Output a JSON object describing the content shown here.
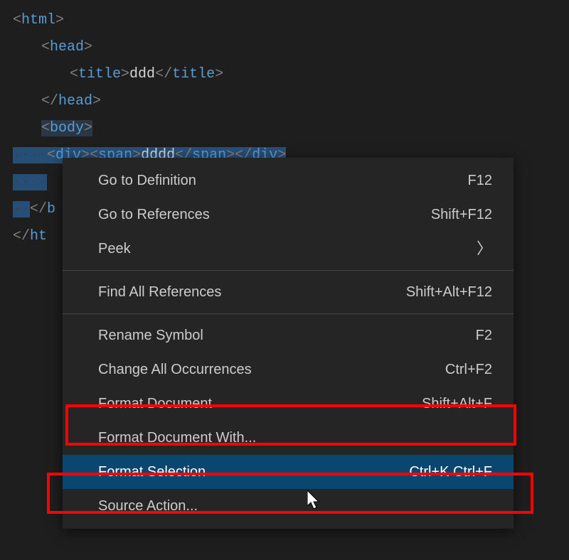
{
  "code": {
    "line1": {
      "open_br": "<",
      "tag": "html",
      "close_br": ">"
    },
    "line2": {
      "open_br": "<",
      "tag": "head",
      "close_br": ">"
    },
    "line3": {
      "open_br_o": "<",
      "tag_o": "title",
      "close_br_o": ">",
      "text": "ddd",
      "open_br_c": "</",
      "tag_c": "title",
      "close_br_c": ">"
    },
    "line4": {
      "open_br": "</",
      "tag": "head",
      "close_br": ">"
    },
    "line5": {
      "open_br": "<",
      "tag": "body",
      "close_br": ">"
    },
    "line6": {
      "ws": "····",
      "div_o_lt": "<",
      "div_o_tag": "div",
      "div_o_gt": ">",
      "span_o_lt": "<",
      "span_o_tag": "span",
      "span_o_gt": ">",
      "text": "dddd",
      "span_c_lt": "</",
      "span_c_tag": "span",
      "span_c_gt": ">",
      "div_c_lt": "</",
      "div_c_tag": "div",
      "div_c_gt": ">"
    },
    "line7": {
      "ws": "····"
    },
    "line8": {
      "ws": "··",
      "open_br": "</",
      "tag_partial": "b"
    },
    "line9": {
      "open_br": "</",
      "tag_partial": "ht"
    }
  },
  "menu": {
    "items": [
      {
        "label": "Go to Definition",
        "shortcut": "F12",
        "submenu": false
      },
      {
        "label": "Go to References",
        "shortcut": "Shift+F12",
        "submenu": false
      },
      {
        "label": "Peek",
        "shortcut": "",
        "submenu": true
      },
      {
        "sep": true
      },
      {
        "label": "Find All References",
        "shortcut": "Shift+Alt+F12",
        "submenu": false
      },
      {
        "sep": true
      },
      {
        "label": "Rename Symbol",
        "shortcut": "F2",
        "submenu": false
      },
      {
        "label": "Change All Occurrences",
        "shortcut": "Ctrl+F2",
        "submenu": false
      },
      {
        "label": "Format Document",
        "shortcut": "Shift+Alt+F",
        "submenu": false,
        "highlight": "red"
      },
      {
        "label": "Format Document With...",
        "shortcut": "",
        "submenu": false
      },
      {
        "label": "Format Selection",
        "shortcut": "Ctrl+K Ctrl+F",
        "submenu": false,
        "hover": true,
        "highlight": "red"
      },
      {
        "label": "Source Action...",
        "shortcut": "",
        "submenu": false
      }
    ]
  },
  "annotations": {
    "redbox1": "Format Document highlighted",
    "redbox2": "Format Selection highlighted"
  }
}
